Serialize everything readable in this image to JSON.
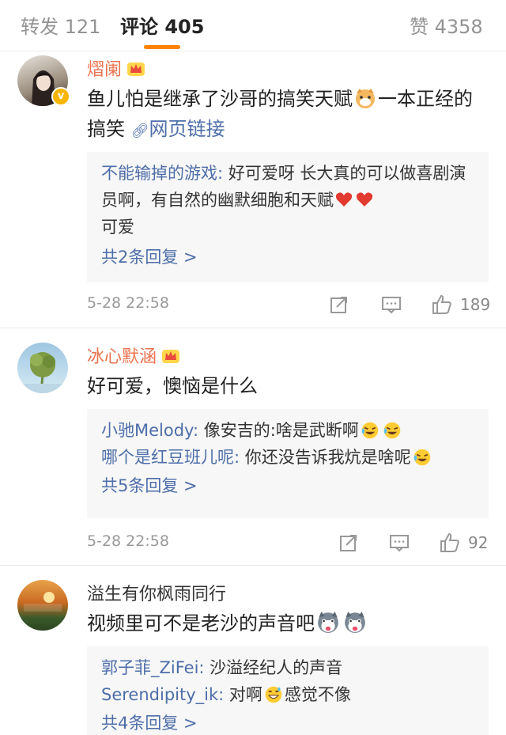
{
  "tabs": {
    "repost": "转发 121",
    "comments": "评论 405",
    "likes": "赞 4358"
  },
  "colors": {
    "accent": "#ff8200",
    "username": "#eb7350",
    "link": "#4e6ea9"
  },
  "comments": [
    {
      "username": "熠阑",
      "text_part1": "鱼儿怕是继承了沙哥的搞笑天赋",
      "text_part2": "一本正经的搞笑",
      "link_text": "网页链接",
      "replies": [
        {
          "name": "不能输掉的游戏:",
          "text": " 好可爱呀  长大真的可以做喜剧演员啊，有自然的幽默细胞和天赋",
          "text2": "可爱"
        }
      ],
      "more": "共2条回复 >",
      "time": "5-28 22:58",
      "likes": "189"
    },
    {
      "username": "冰心默涵",
      "text": "好可爱，懊恼是什么",
      "replies": [
        {
          "name": "小驰Melody:",
          "text": " 像安吉的:啥是武断啊"
        },
        {
          "name": "哪个是红豆班儿呢:",
          "text": " 你还没告诉我炕是啥呢"
        }
      ],
      "more": "共5条回复 >",
      "time": "5-28 22:58",
      "likes": "92"
    },
    {
      "username": "溢生有你枫雨同行",
      "text": "视频里可不是老沙的声音吧",
      "replies": [
        {
          "name": "郭子菲_ZiFei:",
          "text": " 沙溢经纪人的声音"
        },
        {
          "name": "Serendipity_ik:",
          "text": " 对啊",
          "text2": "感觉不像"
        }
      ],
      "more": "共4条回复 >"
    }
  ]
}
